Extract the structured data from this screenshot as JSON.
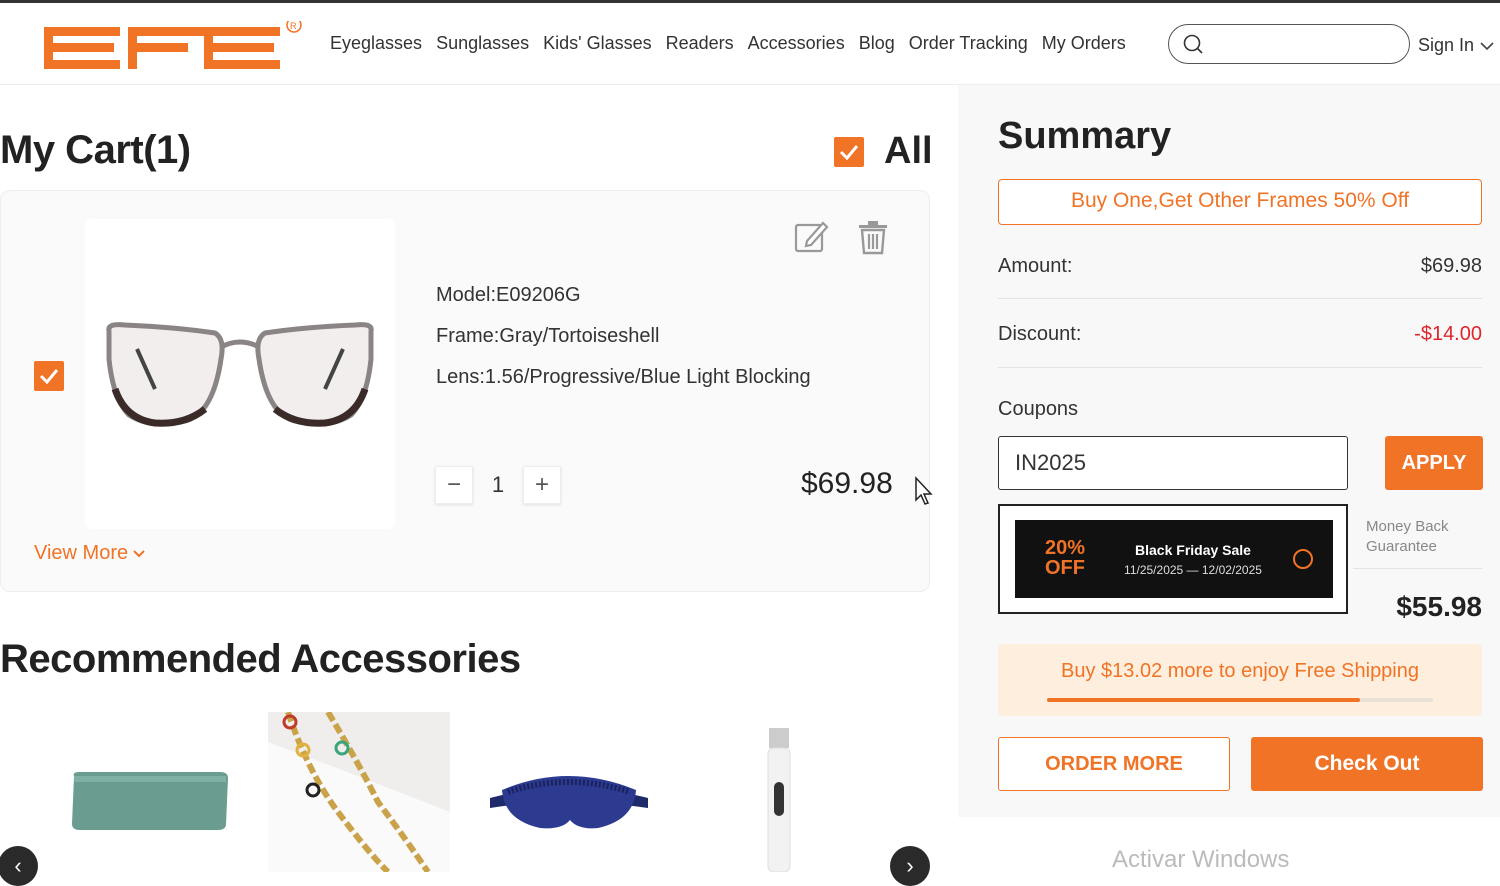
{
  "brand": {
    "logo_text": "EFE",
    "accent": "#f07326"
  },
  "nav": {
    "items": [
      "Eyeglasses",
      "Sunglasses",
      "Kids' Glasses",
      "Readers",
      "Accessories",
      "Blog",
      "Order Tracking",
      "My Orders"
    ],
    "search_placeholder": "",
    "sign_in": "Sign In"
  },
  "cart": {
    "title": "My Cart(1)",
    "select_all_label": "All",
    "item": {
      "model": "Model:E09206G",
      "frame": "Frame:Gray/Tortoiseshell",
      "lens": "Lens:1.56/Progressive/Blue Light Blocking",
      "qty_minus": "−",
      "quantity": "1",
      "qty_plus": "+",
      "price": "$69.98",
      "view_more": "View More"
    }
  },
  "recommended": {
    "title": "Recommended Accessories",
    "prev": "‹",
    "next": "›"
  },
  "summary": {
    "title": "Summary",
    "promo": "Buy One,Get Other Frames 50% Off",
    "amount_label": "Amount:",
    "amount_value": "$69.98",
    "discount_label": "Discount:",
    "discount_value": "-$14.00",
    "coupons_label": "Coupons",
    "coupon_value": "IN2025",
    "apply_label": "APPLY",
    "coupon_option": {
      "pct": "20%",
      "off": "OFF",
      "name": "Black Friday Sale",
      "dates": "11/25/2025 — 12/02/2025"
    },
    "guarantee_line1": "Money Back",
    "guarantee_line2": "Guarantee",
    "total_value": "$55.98",
    "shipping_text": "Buy $13.02 more to enjoy Free Shipping",
    "shipping_progress": 0.81,
    "order_more": "ORDER MORE",
    "checkout": "Check Out"
  },
  "os_watermark": "Activar Windows"
}
